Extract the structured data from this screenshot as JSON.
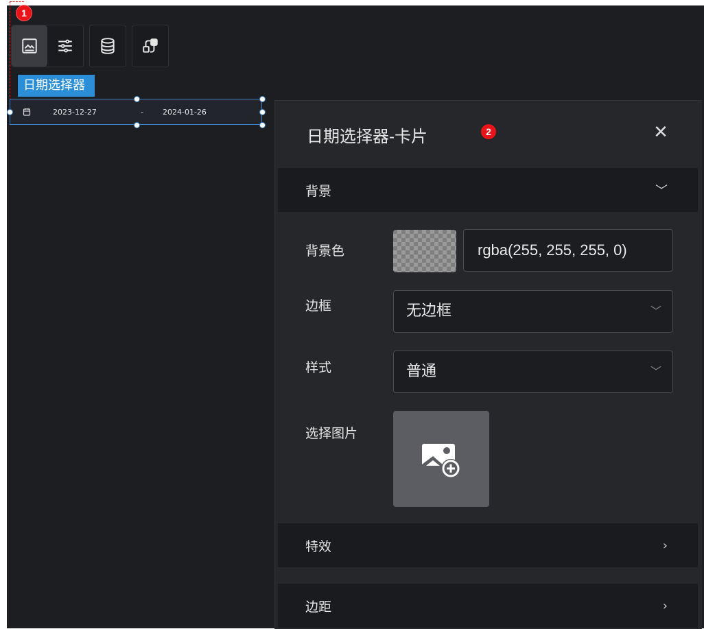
{
  "markers": {
    "step1": "1",
    "step2": "2"
  },
  "toolbar": {
    "icons": [
      "image-icon",
      "sliders-icon",
      "database-icon",
      "interaction-icon"
    ]
  },
  "component": {
    "label": "日期选择器",
    "start_date": "2023-12-27",
    "separator": "-",
    "end_date": "2024-01-26"
  },
  "panel": {
    "title": "日期选择器-卡片",
    "sections": {
      "background": "背景",
      "effects": "特效",
      "margin": "边距"
    },
    "fields": {
      "bg_color_label": "背景色",
      "bg_color_value": "rgba(255, 255, 255, 0)",
      "border_label": "边框",
      "border_value": "无边框",
      "style_label": "样式",
      "style_value": "普通",
      "image_label": "选择图片"
    }
  },
  "colors": {
    "canvas": "#1d1e22",
    "panel": "#26272b",
    "accent": "#2b8ed6",
    "badge": "#e8141a"
  }
}
